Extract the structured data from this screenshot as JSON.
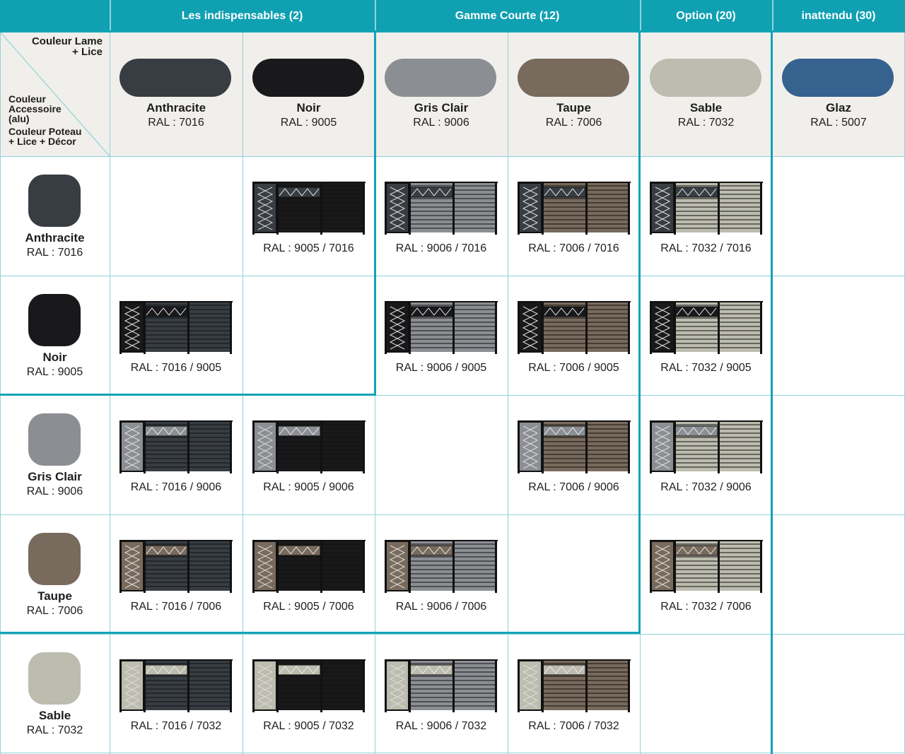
{
  "header_groups": [
    {
      "label": "Les indispensables (2)"
    },
    {
      "label": "Gamme Courte (12)"
    },
    {
      "label": "Option (20)"
    },
    {
      "label": "inattendu (30)"
    }
  ],
  "corner": {
    "top_label_line1": "Couleur Lame",
    "top_label_line2": "+ Lice",
    "bottom_label_1_line1": "Couleur",
    "bottom_label_1_line2": "Accessoire",
    "bottom_label_1_line3": "(alu)",
    "bottom_label_2_line1": "Couleur Poteau",
    "bottom_label_2_line2": "+ Lice + Décor"
  },
  "columns": [
    {
      "name": "Anthracite",
      "ral": "RAL : 7016",
      "color": "#383d43"
    },
    {
      "name": "Noir",
      "ral": "RAL : 9005",
      "color": "#19191b"
    },
    {
      "name": "Gris Clair",
      "ral": "RAL : 9006",
      "color": "#8b8e92"
    },
    {
      "name": "Taupe",
      "ral": "RAL : 7006",
      "color": "#786a5c"
    },
    {
      "name": "Sable",
      "ral": "RAL : 7032",
      "color": "#bcbcaf"
    },
    {
      "name": "Glaz",
      "ral": "RAL : 5007",
      "color": "#35628f"
    }
  ],
  "rows": [
    {
      "name": "Anthracite",
      "ral": "RAL : 7016",
      "color": "#383d43",
      "cells": [
        null,
        "RAL : 9005 / 7016",
        "RAL : 9006 / 7016",
        "RAL : 7006 / 7016",
        "RAL : 7032 / 7016",
        null
      ]
    },
    {
      "name": "Noir",
      "ral": "RAL : 9005",
      "color": "#19191b",
      "cells": [
        "RAL : 7016 / 9005",
        null,
        "RAL : 9006 / 9005",
        "RAL : 7006 / 9005",
        "RAL : 7032 / 9005",
        null
      ]
    },
    {
      "name": "Gris Clair",
      "ral": "RAL : 9006",
      "color": "#8b8e92",
      "cells": [
        "RAL : 7016 / 9006",
        "RAL : 9005 / 9006",
        null,
        "RAL : 7006 / 9006",
        "RAL : 7032 / 9006",
        null
      ]
    },
    {
      "name": "Taupe",
      "ral": "RAL : 7006",
      "color": "#786a5c",
      "cells": [
        "RAL : 7016 / 7006",
        "RAL : 9005 / 7006",
        "RAL : 9006 / 7006",
        null,
        "RAL : 7032 / 7006",
        null
      ]
    },
    {
      "name": "Sable",
      "ral": "RAL : 7032",
      "color": "#bcbcaf",
      "cells": [
        "RAL : 7016 / 7032",
        "RAL : 9005 / 7032",
        "RAL : 9006 / 7032",
        "RAL : 7006 / 7032",
        null,
        null
      ]
    }
  ],
  "colors": {
    "accent": "#0fa0b2",
    "header_bg": "#f1efeb"
  }
}
